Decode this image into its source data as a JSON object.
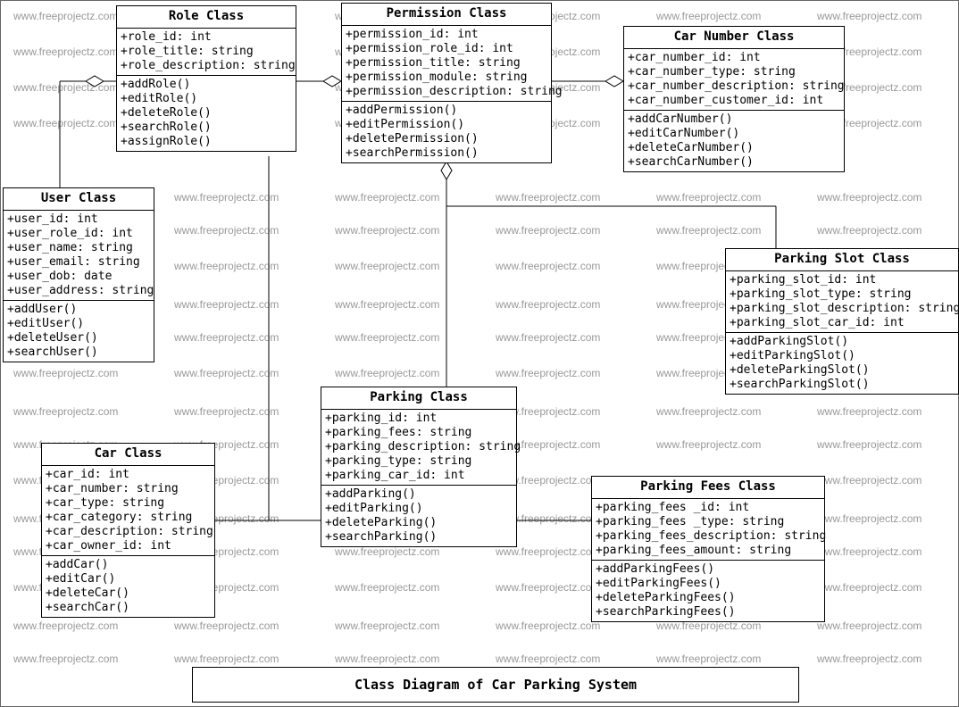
{
  "diagram_title": "Class Diagram of Car Parking System",
  "watermark_text": "www.freeprojectz.com",
  "classes": {
    "role": {
      "title": "Role Class",
      "attrs": [
        "+role_id: int",
        "+role_title: string",
        "+role_description: string"
      ],
      "ops": [
        "+addRole()",
        "+editRole()",
        "+deleteRole()",
        "+searchRole()",
        "+assignRole()"
      ]
    },
    "permission": {
      "title": "Permission Class",
      "attrs": [
        "+permission_id: int",
        "+permission_role_id: int",
        "+permission_title: string",
        "+permission_module: string",
        "+permission_description: string"
      ],
      "ops": [
        "+addPermission()",
        "+editPermission()",
        "+deletePermission()",
        "+searchPermission()"
      ]
    },
    "car_number": {
      "title": "Car Number Class",
      "attrs": [
        "+car_number_id: int",
        "+car_number_type: string",
        "+car_number_description: string",
        "+car_number_customer_id: int"
      ],
      "ops": [
        "+addCarNumber()",
        "+editCarNumber()",
        "+deleteCarNumber()",
        "+searchCarNumber()"
      ]
    },
    "user": {
      "title": "User Class",
      "attrs": [
        "+user_id: int",
        "+user_role_id: int",
        "+user_name: string",
        "+user_email: string",
        "+user_dob: date",
        "+user_address: string"
      ],
      "ops": [
        "+addUser()",
        "+editUser()",
        "+deleteUser()",
        "+searchUser()"
      ]
    },
    "parking_slot": {
      "title": "Parking Slot Class",
      "attrs": [
        "+parking_slot_id: int",
        "+parking_slot_type: string",
        "+parking_slot_description: string",
        "+parking_slot_car_id: int"
      ],
      "ops": [
        "+addParkingSlot()",
        "+editParkingSlot()",
        "+deleteParkingSlot()",
        "+searchParkingSlot()"
      ]
    },
    "car": {
      "title": "Car Class",
      "attrs": [
        "+car_id: int",
        "+car_number: string",
        "+car_type: string",
        "+car_category: string",
        "+car_description: string",
        "+car_owner_id: int"
      ],
      "ops": [
        "+addCar()",
        "+editCar()",
        "+deleteCar()",
        "+searchCar()"
      ]
    },
    "parking": {
      "title": "Parking Class",
      "attrs": [
        "+parking_id: int",
        "+parking_fees: string",
        "+parking_description: string",
        "+parking_type: string",
        "+parking_car_id: int"
      ],
      "ops": [
        "+addParking()",
        "+editParking()",
        "+deleteParking()",
        "+searchParking()"
      ]
    },
    "parking_fees": {
      "title": "Parking Fees Class",
      "attrs": [
        "+parking_fees _id: int",
        "+parking_fees _type: string",
        "+parking_fees_description: string",
        "+parking_fees_amount: string"
      ],
      "ops": [
        "+addParkingFees()",
        "+editParkingFees()",
        "+deleteParkingFees()",
        "+searchParkingFees()"
      ]
    }
  }
}
